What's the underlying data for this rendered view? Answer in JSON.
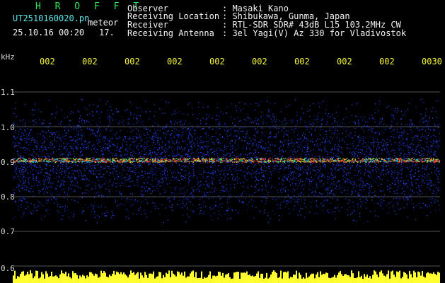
{
  "header": {
    "title": "H R O F F T",
    "filename": "UT2510160020.pn",
    "mode": "meteor",
    "datetime": "25.10.16 00:20",
    "frame": "17."
  },
  "info": {
    "observer_label": "Observer",
    "observer_value": ": Masaki Kano",
    "location_label": "Receiving Location",
    "location_value": ": Shibukawa, Gunma, Japan",
    "receiver_label": "Receiver",
    "receiver_value": ": RTL-SDR SDR# 43dB L15 103.2MHz CW",
    "antenna_label": "Receiving Antenna",
    "antenna_value": ": 3el Yagi(V) Az 330 for Vladivostok"
  },
  "axis": {
    "unit": "kHz",
    "freq_ticks": [
      "1.1",
      "1.0",
      "0.9",
      "0.8",
      "0.7",
      "0.6"
    ],
    "time_ticks": [
      "002",
      "002",
      "002",
      "002",
      "002",
      "002",
      "002",
      "002",
      "002",
      "0030"
    ]
  },
  "colors": {
    "background": "#000000",
    "title": "#2ee85a",
    "info": "#f2f2f2",
    "filename": "#5ee6e6",
    "time_labels": "#f5f53a",
    "noise": "#2030ff",
    "signal": "#ff3020",
    "bottom_plot": "#ffff30"
  }
}
